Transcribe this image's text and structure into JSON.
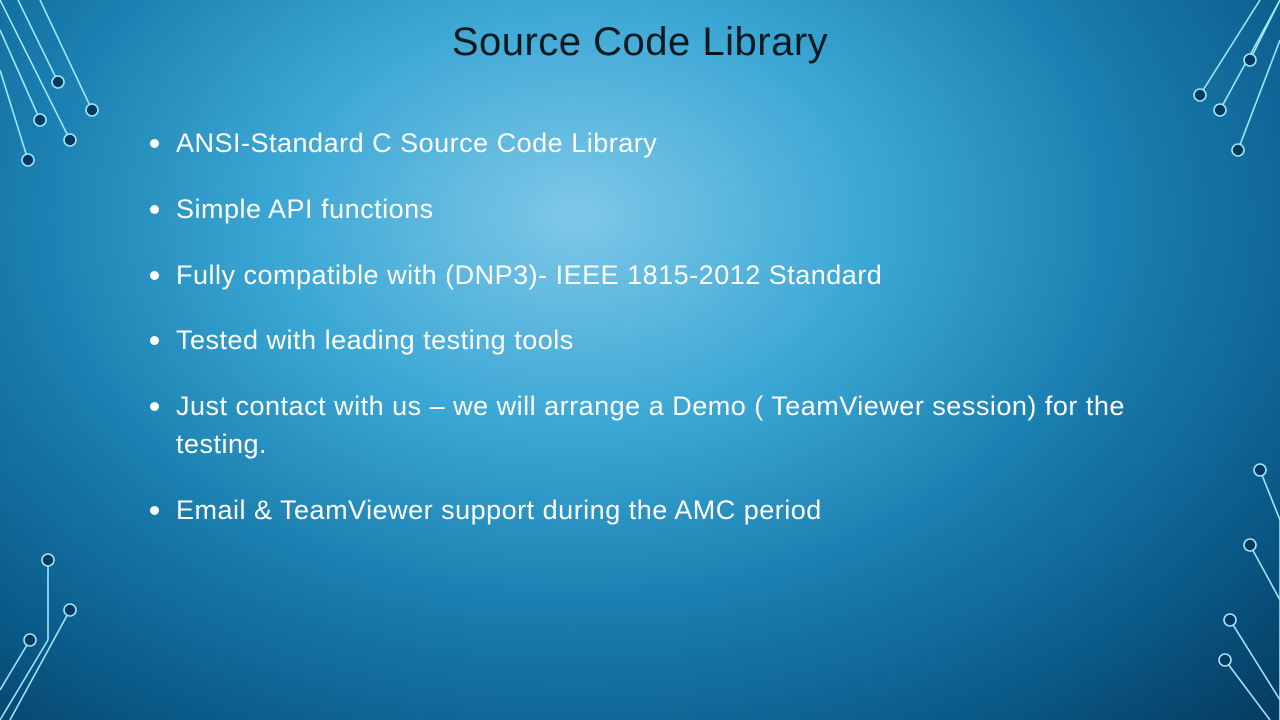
{
  "title": "Source Code Library",
  "bullets": [
    "ANSI-Standard C Source Code Library",
    "Simple API functions",
    "Fully compatible with (DNP3)- IEEE 1815-2012 Standard",
    "Tested with leading testing tools",
    "Just contact with us – we will arrange a Demo ( TeamViewer session) for the testing.",
    "Email & TeamViewer support during the AMC period"
  ]
}
